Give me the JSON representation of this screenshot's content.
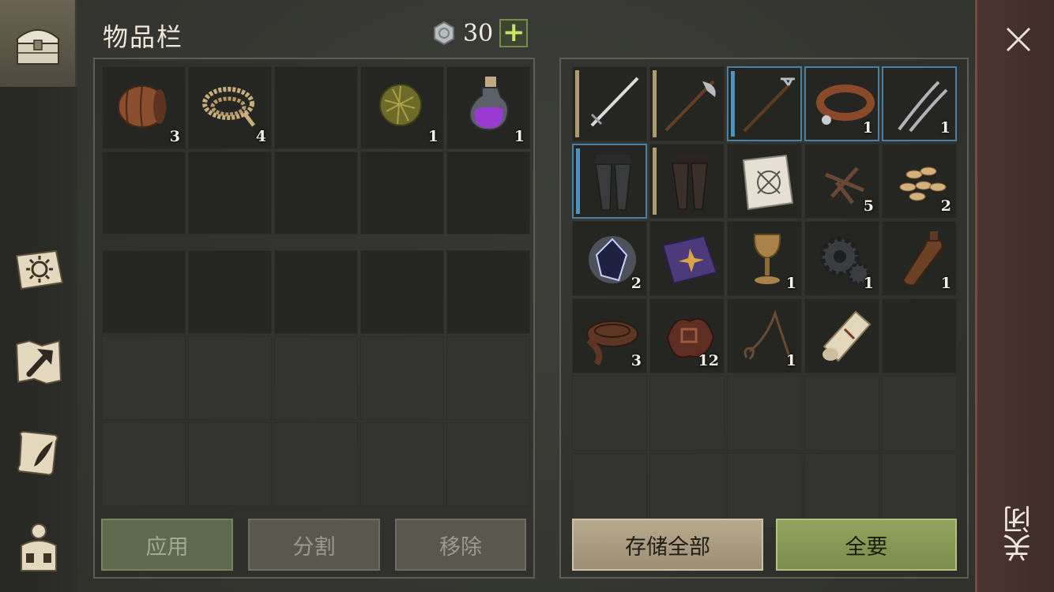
{
  "header": {
    "title": "物品栏",
    "currency_amount": "30",
    "add_currency_label": "+"
  },
  "nav": {
    "tabs": [
      {
        "id": "inventory",
        "icon": "chest-icon"
      },
      {
        "id": "skills",
        "icon": "sun-book-icon"
      },
      {
        "id": "crafting",
        "icon": "hammer-map-icon"
      },
      {
        "id": "quests",
        "icon": "scroll-quill-icon"
      },
      {
        "id": "character",
        "icon": "backpack-icon"
      }
    ]
  },
  "inventory": {
    "slots": [
      {
        "item": "wooden-barrel",
        "count": "3"
      },
      {
        "item": "rope",
        "count": "4"
      },
      {
        "item": "",
        "count": ""
      },
      {
        "item": "plant-fiber-ball",
        "count": "1"
      },
      {
        "item": "purple-potion",
        "count": "1"
      }
    ]
  },
  "actions": {
    "apply": "应用",
    "split": "分割",
    "remove": "移除"
  },
  "storage": {
    "slots": [
      {
        "item": "sword",
        "count": ""
      },
      {
        "item": "halberd",
        "count": ""
      },
      {
        "item": "trident",
        "count": ""
      },
      {
        "item": "leather-collar",
        "count": "1"
      },
      {
        "item": "tongs",
        "count": "1"
      },
      {
        "item": "armored-leggings",
        "count": ""
      },
      {
        "item": "leather-leggings",
        "count": ""
      },
      {
        "item": "blueprint",
        "count": ""
      },
      {
        "item": "nails",
        "count": "5"
      },
      {
        "item": "seeds",
        "count": "2"
      },
      {
        "item": "crystal",
        "count": "2"
      },
      {
        "item": "purple-book",
        "count": ""
      },
      {
        "item": "goblet",
        "count": "1"
      },
      {
        "item": "gears",
        "count": "1"
      },
      {
        "item": "bottle",
        "count": "1"
      },
      {
        "item": "leather-roll",
        "count": "3"
      },
      {
        "item": "scrap-pile",
        "count": "12"
      },
      {
        "item": "whip",
        "count": "1"
      },
      {
        "item": "paper-scroll",
        "count": ""
      }
    ],
    "store_all": "存储全部",
    "take_all": "全要"
  },
  "close": {
    "label": "关闭"
  },
  "colors": {
    "accent_green": "#93a35f",
    "accent_beige": "#b7a98d",
    "rarity_blue": "#4e92c2",
    "close_red": "#7a4a40"
  }
}
